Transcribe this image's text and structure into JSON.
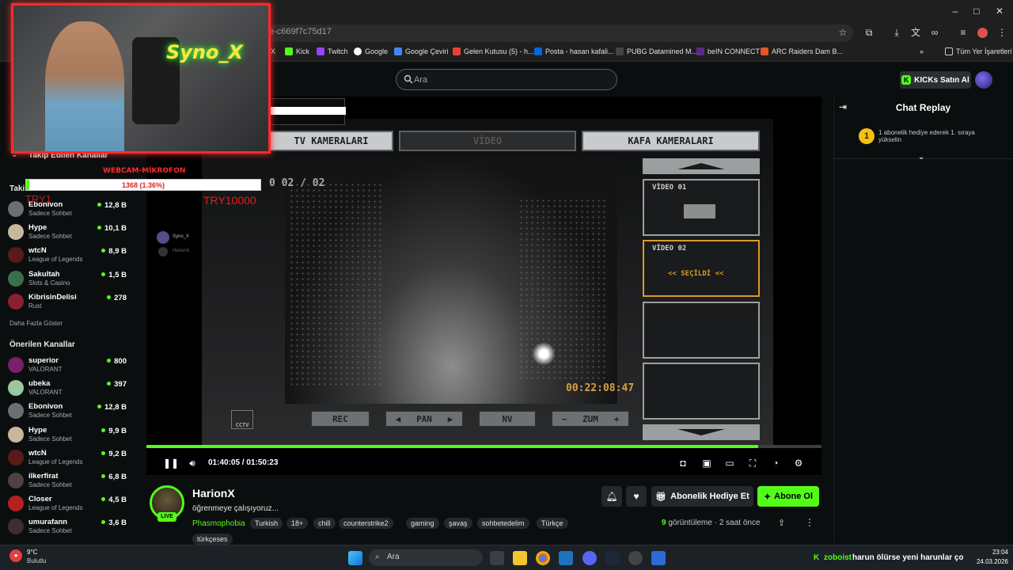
{
  "browser": {
    "url": "e-c669f7c75d17",
    "bookmarks": [
      "X",
      "Kick",
      "Twitch",
      "Google",
      "Google Çeviri",
      "Gelen Kutusu (5) - h...",
      "Posta - hasan kafali...",
      "PUBG Datamined M...",
      "beIN CONNECT",
      "ARC Raiders Dam B..."
    ],
    "bookmarks_more": "»",
    "all_bookmarks": "Tüm Yer İşaretleri"
  },
  "header": {
    "search_placeholder": "Ara",
    "buy_kicks": "KICKs Satın Al"
  },
  "sidebar": {
    "followed_title": "Takip Edilen Kanallar",
    "followed_short": "Taki",
    "followed": [
      {
        "name": "Ebonivon",
        "category": "Sadece Sohbet",
        "viewers": "12,8 B",
        "avatar_color": "#6b6f73"
      },
      {
        "name": "Hype",
        "category": "Sadece Sohbet",
        "viewers": "10,1 B",
        "avatar_color": "#c9b79b"
      },
      {
        "name": "wtcN",
        "category": "League of Legends",
        "viewers": "8,9 B",
        "avatar_color": "#5b1a1a"
      },
      {
        "name": "Sakultah",
        "category": "Slots & Casino",
        "viewers": "1,5 B",
        "avatar_color": "#3a6f4a"
      },
      {
        "name": "KibrisinDelisi",
        "category": "Rust",
        "viewers": "278",
        "avatar_color": "#8a1f2e"
      }
    ],
    "show_more": "Daha Fazla Göster",
    "recommended_title": "Önerilen Kanallar",
    "recommended": [
      {
        "name": "superior",
        "category": "VALORANT",
        "viewers": "800",
        "avatar_color": "#7a1f6a"
      },
      {
        "name": "ubeka",
        "category": "VALORANT",
        "viewers": "397",
        "avatar_color": "#9ac7a0"
      },
      {
        "name": "Ebonivon",
        "category": "Sadece Sohbet",
        "viewers": "12,8 B",
        "avatar_color": "#6b6f73"
      },
      {
        "name": "Hype",
        "category": "Sadece Sohbet",
        "viewers": "9,9 B",
        "avatar_color": "#c9b79b"
      },
      {
        "name": "wtcN",
        "category": "League of Legends",
        "viewers": "9,2 B",
        "avatar_color": "#5b1a1a"
      },
      {
        "name": "ilkerfirat",
        "category": "Sadece Sohbet",
        "viewers": "6,8 B",
        "avatar_color": "#4a4340"
      },
      {
        "name": "Closer",
        "category": "League of Legends",
        "viewers": "4,5 B",
        "avatar_color": "#b42020"
      },
      {
        "name": "umurafann",
        "category": "Sadece Sohbet",
        "viewers": "3,6 B",
        "avatar_color": "#3b3030"
      }
    ]
  },
  "overlay": {
    "neon_sign": "Syno_X",
    "webcam_label": "WEBCAM-MİKROFON",
    "donation_progress": "1368 (1.36%)",
    "donation_fraction": 0.0136,
    "try_small": "TRY1",
    "try_goal": "TRY10000",
    "chat_user": "Syno_X",
    "chat_user2": "HarionX"
  },
  "game": {
    "tab_left": "TV KAMERALARI",
    "tab_mid": "VİDEO",
    "tab_right": "KAFA KAMERALARI",
    "page": "0 02 / 02",
    "timestamp": "00:22:08:47",
    "buttons": {
      "rec": "REC",
      "pan": "PAN",
      "nv": "NV",
      "zum": "ZUM"
    },
    "videos": [
      {
        "label": "VİDEO 01",
        "status": ""
      },
      {
        "label": "VİDEO 02",
        "status": "<<  SEÇİLDİ  <<"
      },
      {
        "label": "",
        "status": ""
      },
      {
        "label": "",
        "status": ""
      }
    ],
    "cctv_label": "CCTV"
  },
  "player": {
    "time_current": "01:40:05",
    "time_total": "01:50:23",
    "progress_fraction": 0.906
  },
  "chat": {
    "title": "Chat Replay",
    "pinned_rank": "1",
    "pinned_text": "1 abonelik hediye ederek 1. sıraya yükselin"
  },
  "stream": {
    "streamer": "HarionX",
    "title": "öğrenmeye çalışıyoruz...",
    "live_badge": "LIVE",
    "category": "Phasmophobia",
    "tags": [
      "Turkish",
      "18+",
      "chill",
      "counterstrike2",
      "gaming",
      "şavaş",
      "sohbetedelim",
      "Türkçe",
      "türkçeses"
    ],
    "gift_label": "Abonelik Hediye Et",
    "subscribe_label": "Abone Ol",
    "views_count": "9",
    "views_label": "görüntüleme",
    "time_ago": "2 saat önce"
  },
  "taskbar": {
    "weather_temp": "9°C",
    "weather_text": "Bulutlu",
    "search_placeholder": "Ara",
    "ticker_user": "zoboist",
    "ticker_text": "harun ölürse yeni harunlar çok b",
    "time": "23:04",
    "date": "24.03.2026"
  }
}
